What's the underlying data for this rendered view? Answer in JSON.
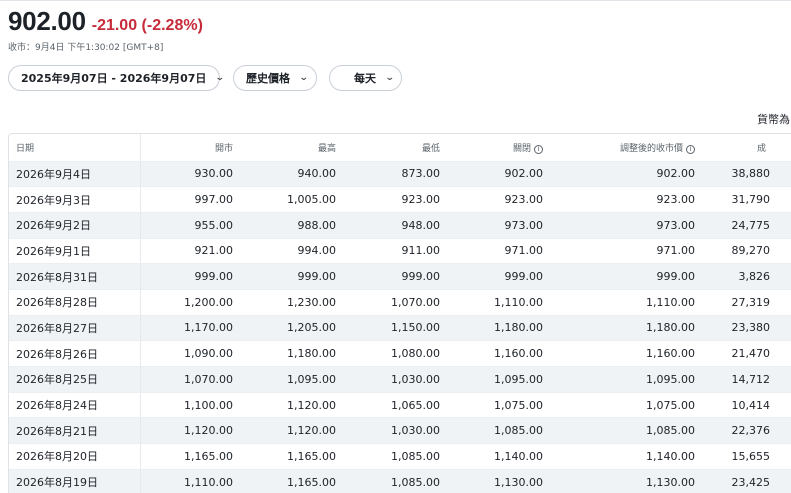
{
  "quote": {
    "price": "902.00",
    "change": "-21.00 (-2.28%)",
    "market_time": "收市：9月4日 下午1:30:02 [GMT+8]"
  },
  "controls": {
    "date_range": "2025年9月07日 - 2026年9月07日",
    "data_type": "歷史價格",
    "frequency": "每天"
  },
  "currency_note": "貨幣為",
  "colors": {
    "negative": "#c72b3a",
    "row_stripe": "#f0f3f5"
  },
  "table": {
    "headers": {
      "date": "日期",
      "open": "開市",
      "high": "最高",
      "low": "最低",
      "close": "關閉",
      "adj_close": "調整後的收市價",
      "volume": "成"
    },
    "rows": [
      {
        "date": "2026年9月4日",
        "open": "930.00",
        "high": "940.00",
        "low": "873.00",
        "close": "902.00",
        "adj_close": "902.00",
        "volume": "38,880"
      },
      {
        "date": "2026年9月3日",
        "open": "997.00",
        "high": "1,005.00",
        "low": "923.00",
        "close": "923.00",
        "adj_close": "923.00",
        "volume": "31,790"
      },
      {
        "date": "2026年9月2日",
        "open": "955.00",
        "high": "988.00",
        "low": "948.00",
        "close": "973.00",
        "adj_close": "973.00",
        "volume": "24,775"
      },
      {
        "date": "2026年9月1日",
        "open": "921.00",
        "high": "994.00",
        "low": "911.00",
        "close": "971.00",
        "adj_close": "971.00",
        "volume": "89,270"
      },
      {
        "date": "2026年8月31日",
        "open": "999.00",
        "high": "999.00",
        "low": "999.00",
        "close": "999.00",
        "adj_close": "999.00",
        "volume": "3,826"
      },
      {
        "date": "2026年8月28日",
        "open": "1,200.00",
        "high": "1,230.00",
        "low": "1,070.00",
        "close": "1,110.00",
        "adj_close": "1,110.00",
        "volume": "27,319"
      },
      {
        "date": "2026年8月27日",
        "open": "1,170.00",
        "high": "1,205.00",
        "low": "1,150.00",
        "close": "1,180.00",
        "adj_close": "1,180.00",
        "volume": "23,380"
      },
      {
        "date": "2026年8月26日",
        "open": "1,090.00",
        "high": "1,180.00",
        "low": "1,080.00",
        "close": "1,160.00",
        "adj_close": "1,160.00",
        "volume": "21,470"
      },
      {
        "date": "2026年8月25日",
        "open": "1,070.00",
        "high": "1,095.00",
        "low": "1,030.00",
        "close": "1,095.00",
        "adj_close": "1,095.00",
        "volume": "14,712"
      },
      {
        "date": "2026年8月24日",
        "open": "1,100.00",
        "high": "1,120.00",
        "low": "1,065.00",
        "close": "1,075.00",
        "adj_close": "1,075.00",
        "volume": "10,414"
      },
      {
        "date": "2026年8月21日",
        "open": "1,120.00",
        "high": "1,120.00",
        "low": "1,030.00",
        "close": "1,085.00",
        "adj_close": "1,085.00",
        "volume": "22,376"
      },
      {
        "date": "2026年8月20日",
        "open": "1,165.00",
        "high": "1,165.00",
        "low": "1,085.00",
        "close": "1,140.00",
        "adj_close": "1,140.00",
        "volume": "15,655"
      },
      {
        "date": "2026年8月19日",
        "open": "1,110.00",
        "high": "1,165.00",
        "low": "1,085.00",
        "close": "1,130.00",
        "adj_close": "1,130.00",
        "volume": "23,425"
      }
    ]
  }
}
